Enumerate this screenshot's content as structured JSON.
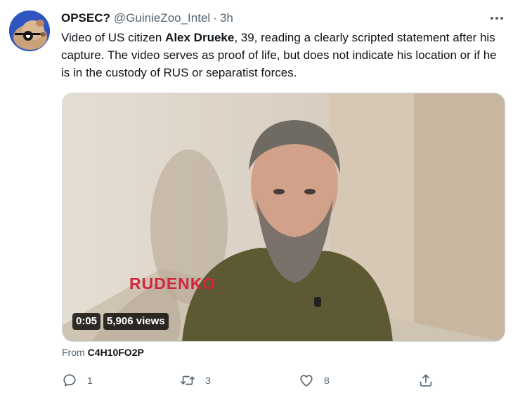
{
  "tweet": {
    "author_name": "OPSEC?",
    "handle": "@GuinieZoo_Intel",
    "separator": "·",
    "time": "3h",
    "text": {
      "part1": "Video of US citizen ",
      "bold_name": "Alex Drueke",
      "part2": ", 39, reading a clearly scripted statement after his capture. The video serves as proof of life, but does not indicate his location or if he is in the custody of RUS or separatist forces."
    }
  },
  "media": {
    "watermark": "RUDENKO",
    "duration": "0:05",
    "views": "5,906 views"
  },
  "source": {
    "prefix": "From",
    "name": "C4H10FO2P"
  },
  "actions": {
    "reply_count": "1",
    "retweet_count": "3",
    "like_count": "8"
  },
  "icons": {
    "more": "more-horizontal-icon",
    "reply": "reply-icon",
    "retweet": "retweet-icon",
    "like": "heart-icon",
    "share": "share-icon"
  }
}
